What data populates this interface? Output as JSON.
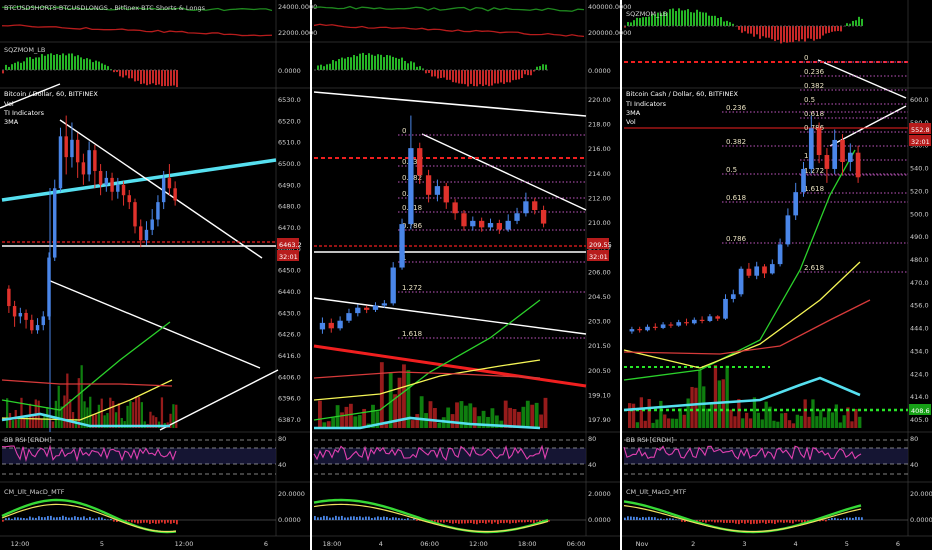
{
  "colors": {
    "background": "#000000",
    "divider": "#ffffff",
    "bull": "#4a86e8",
    "bear": "#e0322c",
    "price_label": "#b71c1c",
    "fib_dotted": "#c156c1",
    "cyan_line": "#56e0f0",
    "red_dashed": "#f01f1f",
    "ma_green": "#2bd12b",
    "ma_yellow": "#f5f556",
    "ma_red": "#d63a3a",
    "rsi_line": "#e040b0",
    "macd_green": "#36d936",
    "macd_red": "#e02020",
    "macd_yellow": "#f0e060",
    "vol_green": "#129412",
    "vol_red": "#b02020",
    "sqz_green": "#26b526",
    "sqz_red": "#c62828",
    "text": "#d0d0d0",
    "bright_green_dash": "#27e627"
  },
  "panels": [
    {
      "main_title": "Bitcoin / Dollar, 60, BITFINEX",
      "legend_lines": [
        "Vol",
        "TI Indicators",
        "3MA"
      ],
      "top_indicator": "BTCUSDSHORTS-BTCUSDLONGS - Bitfinex BTC Shorts & Longs",
      "sqz_label": "SQZMOM_LB",
      "rsi_label": "BB RSI [CRDH]",
      "macd_label": "CM_Ult_MacD_MTF",
      "price_scale": [
        "6530.0",
        "6520.0",
        "6510.0",
        "6500.0",
        "6490.0",
        "6480.0",
        "6470.0",
        "6460.0",
        "6450.0",
        "6440.0",
        "6430.0",
        "6426.0",
        "6416.0",
        "6406.0",
        "6396.0",
        "6387.0"
      ],
      "top_scale": [
        "24000.0000",
        "22000.0000"
      ],
      "sqz_scale": [
        "0.0000"
      ],
      "rsi_scale": [
        "80",
        "40"
      ],
      "macd_scale": [
        "20.0000",
        "0.0000"
      ],
      "time_labels": [
        "12:00",
        "5",
        "12:00",
        "6"
      ],
      "current_price": "6463.2",
      "countdown": "32:01",
      "fib_labels": [],
      "candles": [
        {
          "o": 6412,
          "c": 6402,
          "h": 6414,
          "l": 6398
        },
        {
          "o": 6402,
          "c": 6396,
          "h": 6405,
          "l": 6390
        },
        {
          "o": 6396,
          "c": 6398,
          "h": 6401,
          "l": 6392
        },
        {
          "o": 6398,
          "c": 6394,
          "h": 6400,
          "l": 6389
        },
        {
          "o": 6394,
          "c": 6388,
          "h": 6397,
          "l": 6386
        },
        {
          "o": 6388,
          "c": 6391,
          "h": 6395,
          "l": 6386
        },
        {
          "o": 6391,
          "c": 6396,
          "h": 6399,
          "l": 6388
        },
        {
          "o": 6396,
          "c": 6430,
          "h": 6433,
          "l": 6394
        },
        {
          "o": 6430,
          "c": 6470,
          "h": 6475,
          "l": 6428
        },
        {
          "o": 6470,
          "c": 6500,
          "h": 6505,
          "l": 6468
        },
        {
          "o": 6500,
          "c": 6488,
          "h": 6512,
          "l": 6478
        },
        {
          "o": 6488,
          "c": 6498,
          "h": 6508,
          "l": 6482
        },
        {
          "o": 6498,
          "c": 6485,
          "h": 6502,
          "l": 6476
        },
        {
          "o": 6485,
          "c": 6478,
          "h": 6490,
          "l": 6472
        },
        {
          "o": 6478,
          "c": 6492,
          "h": 6497,
          "l": 6474
        },
        {
          "o": 6492,
          "c": 6480,
          "h": 6495,
          "l": 6470
        },
        {
          "o": 6480,
          "c": 6472,
          "h": 6484,
          "l": 6466
        },
        {
          "o": 6472,
          "c": 6476,
          "h": 6480,
          "l": 6468
        },
        {
          "o": 6476,
          "c": 6468,
          "h": 6479,
          "l": 6463
        },
        {
          "o": 6468,
          "c": 6472,
          "h": 6476,
          "l": 6464
        },
        {
          "o": 6472,
          "c": 6466,
          "h": 6474,
          "l": 6460
        },
        {
          "o": 6466,
          "c": 6462,
          "h": 6469,
          "l": 6458
        },
        {
          "o": 6462,
          "c": 6448,
          "h": 6464,
          "l": 6444
        },
        {
          "o": 6448,
          "c": 6440,
          "h": 6452,
          "l": 6436
        },
        {
          "o": 6440,
          "c": 6446,
          "h": 6451,
          "l": 6437
        },
        {
          "o": 6446,
          "c": 6452,
          "h": 6458,
          "l": 6443
        },
        {
          "o": 6452,
          "c": 6462,
          "h": 6466,
          "l": 6448
        },
        {
          "o": 6462,
          "c": 6476,
          "h": 6480,
          "l": 6458
        },
        {
          "o": 6476,
          "c": 6470,
          "h": 6484,
          "l": 6466
        },
        {
          "o": 6470,
          "c": 6463,
          "h": 6474,
          "l": 6460
        }
      ]
    },
    {
      "main_title": "",
      "legend_lines": [],
      "top_indicator": "",
      "sqz_label": "",
      "rsi_label": "",
      "macd_label": "",
      "price_scale": [
        "220.00",
        "218.00",
        "216.00",
        "214.00",
        "212.00",
        "210.00",
        "208.00",
        "206.00",
        "204.50",
        "203.00",
        "201.50",
        "200.50",
        "199.10",
        "197.90"
      ],
      "top_scale": [
        "400000.0000",
        "200000.0000"
      ],
      "sqz_scale": [
        "0.0000"
      ],
      "rsi_scale": [
        "80",
        "40"
      ],
      "macd_scale": [
        "2.0000",
        "0.0000"
      ],
      "time_labels": [
        "18:00",
        "4",
        "06:00",
        "12:00",
        "18:00",
        "06:00"
      ],
      "current_price": "209.55",
      "countdown": "32:01",
      "fib_labels": [
        "0",
        "0.236",
        "0.382",
        "0.5",
        "0.618",
        "0.786",
        "1",
        "1.272",
        "1.618"
      ],
      "candles": [
        {
          "o": 199.8,
          "c": 200.4,
          "h": 200.9,
          "l": 199.4
        },
        {
          "o": 200.4,
          "c": 199.9,
          "h": 200.8,
          "l": 199.5
        },
        {
          "o": 199.9,
          "c": 200.6,
          "h": 201.0,
          "l": 199.7
        },
        {
          "o": 200.6,
          "c": 201.3,
          "h": 201.7,
          "l": 200.4
        },
        {
          "o": 201.3,
          "c": 201.8,
          "h": 202.1,
          "l": 201.0
        },
        {
          "o": 201.8,
          "c": 201.6,
          "h": 202.0,
          "l": 201.3
        },
        {
          "o": 201.6,
          "c": 202.0,
          "h": 202.3,
          "l": 201.4
        },
        {
          "o": 202.0,
          "c": 202.2,
          "h": 202.5,
          "l": 201.8
        },
        {
          "o": 202.2,
          "c": 205.5,
          "h": 206.0,
          "l": 202.0
        },
        {
          "o": 205.5,
          "c": 209.5,
          "h": 210.0,
          "l": 205.3
        },
        {
          "o": 209.5,
          "c": 216.5,
          "h": 219.5,
          "l": 209.0
        },
        {
          "o": 216.5,
          "c": 214.0,
          "h": 217.0,
          "l": 213.2
        },
        {
          "o": 214.0,
          "c": 212.2,
          "h": 214.5,
          "l": 211.5
        },
        {
          "o": 212.2,
          "c": 213.0,
          "h": 213.6,
          "l": 211.6
        },
        {
          "o": 213.0,
          "c": 211.5,
          "h": 213.3,
          "l": 210.9
        },
        {
          "o": 211.5,
          "c": 210.5,
          "h": 211.8,
          "l": 209.9
        },
        {
          "o": 210.5,
          "c": 209.3,
          "h": 210.8,
          "l": 208.9
        },
        {
          "o": 209.3,
          "c": 209.8,
          "h": 210.2,
          "l": 208.9
        },
        {
          "o": 209.8,
          "c": 209.2,
          "h": 210.1,
          "l": 208.8
        },
        {
          "o": 209.2,
          "c": 209.6,
          "h": 210.0,
          "l": 208.9
        },
        {
          "o": 209.6,
          "c": 209.0,
          "h": 209.9,
          "l": 208.6
        },
        {
          "o": 209.0,
          "c": 209.8,
          "h": 210.4,
          "l": 208.8
        },
        {
          "o": 209.8,
          "c": 210.5,
          "h": 211.0,
          "l": 209.5
        },
        {
          "o": 210.5,
          "c": 211.6,
          "h": 212.4,
          "l": 210.2
        },
        {
          "o": 211.6,
          "c": 210.8,
          "h": 211.9,
          "l": 210.4
        },
        {
          "o": 210.8,
          "c": 209.55,
          "h": 211.2,
          "l": 209.2
        }
      ]
    },
    {
      "main_title": "Bitcoin Cash / Dollar, 60, BITFINEX",
      "legend_lines": [
        "TI Indicators",
        "3MA",
        "Vol"
      ],
      "top_indicator": "SQZMOM_LB",
      "sqz_label": "",
      "rsi_label": "BB RSI [CRDH]",
      "macd_label": "CM_Ult_MacD_MTF",
      "price_scale": [
        "600.0",
        "580.0",
        "560.0",
        "540.0",
        "520.0",
        "500.0",
        "490.0",
        "480.0",
        "470.0",
        "456.0",
        "444.0",
        "434.0",
        "424.0",
        "414.0",
        "405.0"
      ],
      "top_scale": [],
      "sqz_scale": [],
      "rsi_scale": [
        "80",
        "40"
      ],
      "macd_scale": [
        "20.0000",
        "0.0000"
      ],
      "time_labels": [
        "Nov",
        "2",
        "3",
        "4",
        "5",
        "6"
      ],
      "current_price": "552.8",
      "countdown": "32:01",
      "secondary_price": "408.6",
      "fib_labels": [
        "0",
        "0.236",
        "0.382",
        "0.5",
        "0.618",
        "0.786",
        "1",
        "1.272",
        "1.618",
        "2.618",
        "0.236",
        "0.382",
        "0.5",
        "0.618",
        "0.786"
      ],
      "candles": [
        {
          "o": 420,
          "c": 422,
          "h": 424,
          "l": 418
        },
        {
          "o": 422,
          "c": 421,
          "h": 424,
          "l": 419
        },
        {
          "o": 421,
          "c": 424,
          "h": 426,
          "l": 420
        },
        {
          "o": 424,
          "c": 423,
          "h": 427,
          "l": 421
        },
        {
          "o": 423,
          "c": 426,
          "h": 428,
          "l": 422
        },
        {
          "o": 426,
          "c": 425,
          "h": 428,
          "l": 423
        },
        {
          "o": 425,
          "c": 428,
          "h": 430,
          "l": 424
        },
        {
          "o": 428,
          "c": 427,
          "h": 431,
          "l": 425
        },
        {
          "o": 427,
          "c": 430,
          "h": 432,
          "l": 426
        },
        {
          "o": 430,
          "c": 429,
          "h": 433,
          "l": 427
        },
        {
          "o": 429,
          "c": 433,
          "h": 435,
          "l": 428
        },
        {
          "o": 433,
          "c": 431,
          "h": 434,
          "l": 429
        },
        {
          "o": 431,
          "c": 448,
          "h": 452,
          "l": 430
        },
        {
          "o": 448,
          "c": 452,
          "h": 456,
          "l": 445
        },
        {
          "o": 452,
          "c": 474,
          "h": 476,
          "l": 450
        },
        {
          "o": 474,
          "c": 468,
          "h": 479,
          "l": 466
        },
        {
          "o": 468,
          "c": 476,
          "h": 480,
          "l": 465
        },
        {
          "o": 476,
          "c": 470,
          "h": 478,
          "l": 466
        },
        {
          "o": 470,
          "c": 478,
          "h": 482,
          "l": 469
        },
        {
          "o": 478,
          "c": 495,
          "h": 500,
          "l": 476
        },
        {
          "o": 495,
          "c": 520,
          "h": 526,
          "l": 493
        },
        {
          "o": 520,
          "c": 540,
          "h": 548,
          "l": 516
        },
        {
          "o": 540,
          "c": 560,
          "h": 566,
          "l": 536
        },
        {
          "o": 560,
          "c": 595,
          "h": 606,
          "l": 556
        },
        {
          "o": 595,
          "c": 572,
          "h": 600,
          "l": 565
        },
        {
          "o": 572,
          "c": 560,
          "h": 578,
          "l": 548
        },
        {
          "o": 560,
          "c": 585,
          "h": 594,
          "l": 556
        },
        {
          "o": 585,
          "c": 566,
          "h": 590,
          "l": 555
        },
        {
          "o": 566,
          "c": 574,
          "h": 582,
          "l": 558
        },
        {
          "o": 574,
          "c": 552.8,
          "h": 580,
          "l": 548
        }
      ]
    }
  ]
}
